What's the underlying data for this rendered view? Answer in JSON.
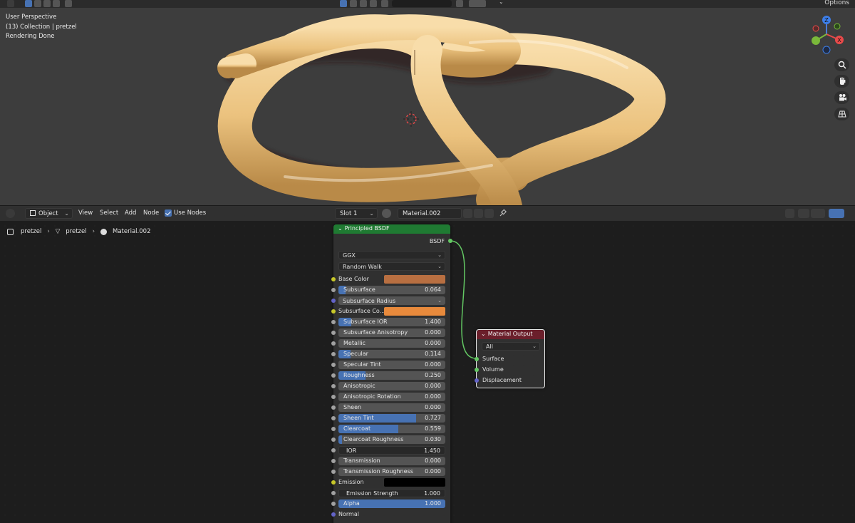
{
  "viewport": {
    "info": [
      "User Perspective",
      "(13) Collection | pretzel",
      "Rendering Done"
    ],
    "options_label": "Options",
    "axis": {
      "z": "Z",
      "x": "X",
      "y": "Y"
    },
    "nav_icons": [
      "zoom-icon",
      "hand-pan-icon",
      "camera-icon",
      "grid-icon"
    ],
    "accent": "#4772b3"
  },
  "header": {
    "mode": "Object",
    "menus": [
      "View",
      "Select",
      "Add",
      "Node"
    ],
    "use_nodes_label": "Use Nodes",
    "slot": "Slot 1",
    "material": "Material.002"
  },
  "breadcrumb": [
    "pretzel",
    "pretzel",
    "Material.002"
  ],
  "principled": {
    "title": "Principled BSDF",
    "output": "BSDF",
    "distribution": "GGX",
    "subsurface_method": "Random Walk",
    "base_color_label": "Base Color",
    "base_color": "#b86f41",
    "subsurface": {
      "label": "Subsurface",
      "value": "0.064",
      "fraction": 0.064
    },
    "subsurface_radius": "Subsurface Radius",
    "subsurface_color_label": "Subsurface Co...",
    "subsurface_color": "#e88a3c",
    "subsurface_ior": {
      "label": "Subsurface IOR",
      "value": "1.400",
      "fraction": 0.12
    },
    "subsurface_anisotropy": {
      "label": "Subsurface Anisotropy",
      "value": "0.000",
      "fraction": 0
    },
    "metallic": {
      "label": "Metallic",
      "value": "0.000",
      "fraction": 0
    },
    "specular": {
      "label": "Specular",
      "value": "0.114",
      "fraction": 0.114
    },
    "specular_tint": {
      "label": "Specular Tint",
      "value": "0.000",
      "fraction": 0
    },
    "roughness": {
      "label": "Roughness",
      "value": "0.250",
      "fraction": 0.25
    },
    "anisotropic": {
      "label": "Anisotropic",
      "value": "0.000",
      "fraction": 0
    },
    "anisotropic_rotation": {
      "label": "Anisotropic Rotation",
      "value": "0.000",
      "fraction": 0
    },
    "sheen": {
      "label": "Sheen",
      "value": "0.000",
      "fraction": 0
    },
    "sheen_tint": {
      "label": "Sheen Tint",
      "value": "0.727",
      "fraction": 0.727
    },
    "clearcoat": {
      "label": "Clearcoat",
      "value": "0.559",
      "fraction": 0.559
    },
    "clearcoat_roughness": {
      "label": "Clearcoat Roughness",
      "value": "0.030",
      "fraction": 0.03
    },
    "ior": {
      "label": "IOR",
      "value": "1.450"
    },
    "transmission": {
      "label": "Transmission",
      "value": "0.000",
      "fraction": 0
    },
    "transmission_roughness": {
      "label": "Transmission Roughness",
      "value": "0.000",
      "fraction": 0
    },
    "emission_label": "Emission",
    "emission_color": "#000000",
    "emission_strength": {
      "label": "Emission Strength",
      "value": "1.000"
    },
    "alpha": {
      "label": "Alpha",
      "value": "1.000",
      "fraction": 1
    },
    "normal_label": "Normal"
  },
  "material_output": {
    "title": "Material Output",
    "target": "All",
    "inputs": [
      "Surface",
      "Volume",
      "Displacement"
    ]
  }
}
